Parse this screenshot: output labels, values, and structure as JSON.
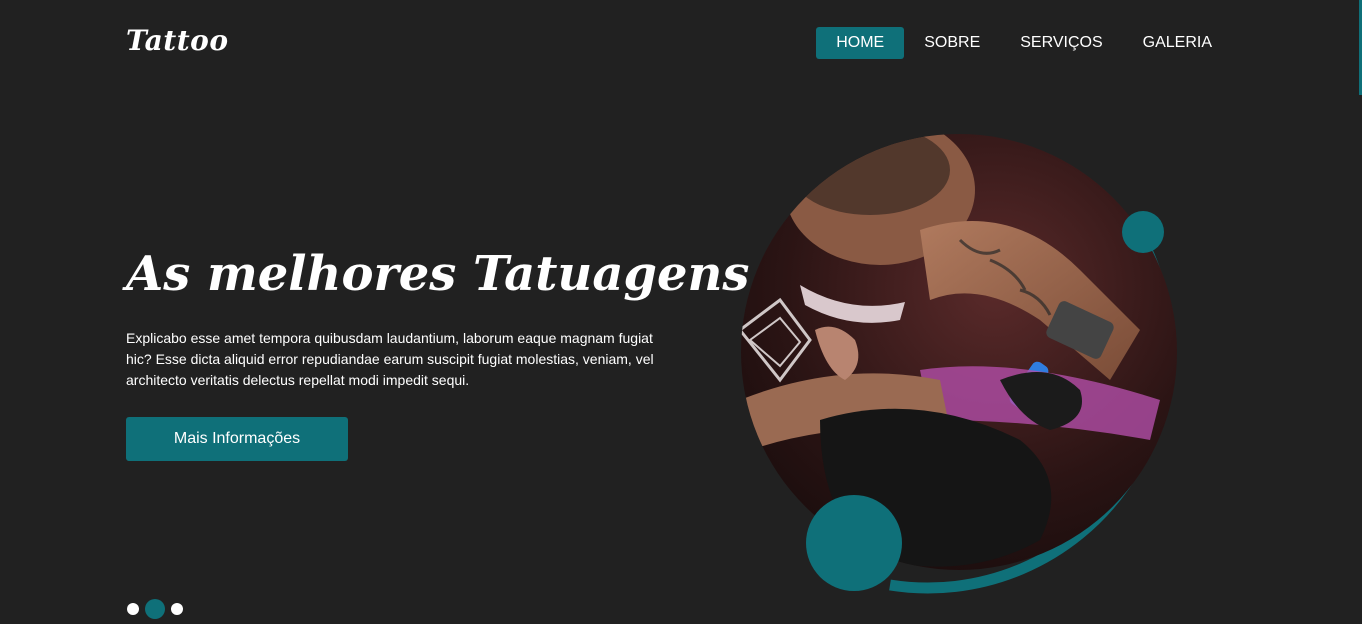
{
  "brand": {
    "logo_text": "Tattoo"
  },
  "nav": {
    "items": [
      {
        "label": "HOME",
        "active": true
      },
      {
        "label": "SOBRE",
        "active": false
      },
      {
        "label": "SERVIÇOS",
        "active": false
      },
      {
        "label": "GALERIA",
        "active": false
      }
    ]
  },
  "hero": {
    "title": "As melhores Tatuagens",
    "description": "Explicabo esse amet tempora quibusdam laudantium, laborum eaque magnam fugiat hic? Esse dicta aliquid error repudiandae earum suscipit fugiat molestias, veniam, vel architecto veritatis delectus repellat modi impedit sequi.",
    "cta_label": "Mais Informações",
    "image_icon": "tattoo-artist-photo"
  },
  "slider": {
    "count": 3,
    "active_index": 1
  },
  "colors": {
    "background": "#212121",
    "accent": "#0f7079",
    "text": "#ffffff"
  }
}
